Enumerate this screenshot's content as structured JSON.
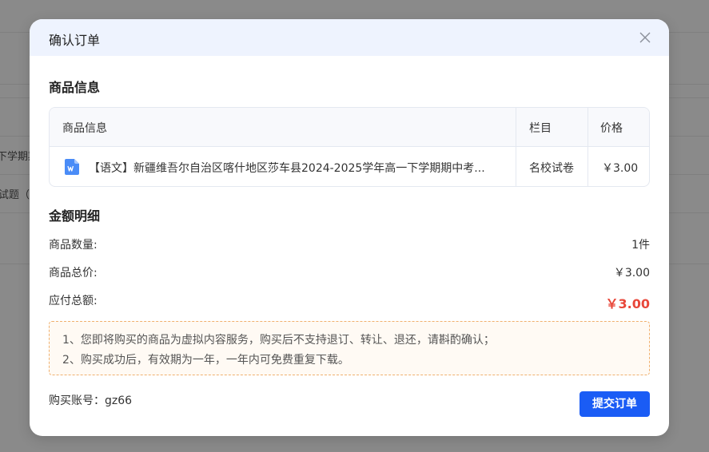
{
  "background": {
    "fragments": [
      "下学期期",
      "试题（"
    ]
  },
  "modal": {
    "title": "确认订单"
  },
  "goods_section": {
    "title": "商品信息",
    "columns": [
      "商品信息",
      "栏目",
      "价格"
    ],
    "rows": [
      {
        "icon": "word-doc-icon",
        "name": "【语文】新疆维吾尔自治区喀什地区莎车县2024-2025学年高一下学期期中考...",
        "category": "名校试卷",
        "price": "￥3.00"
      }
    ]
  },
  "amount_section": {
    "title": "金额明细",
    "quantity_label": "商品数量:",
    "quantity_value": "1件",
    "total_label": "商品总价:",
    "total_value": "￥3.00",
    "payable_label": "应付总额:",
    "payable_value": "￥3.00"
  },
  "notice": {
    "lines": [
      "1、您即将购买的商品为虚拟内容服务，购买后不支持退订、转让、退还，请斟酌确认；",
      "2、购买成功后，有效期为一年，一年内可免费重复下载。"
    ]
  },
  "account": {
    "label": "购买账号：gz66"
  },
  "actions": {
    "submit_label": "提交订单"
  },
  "colors": {
    "header_bg": "#eef3fe",
    "primary": "#1a5cf5",
    "price_red": "#e8473a",
    "notice_border": "#f0b06e",
    "notice_bg": "#fffaf4"
  }
}
